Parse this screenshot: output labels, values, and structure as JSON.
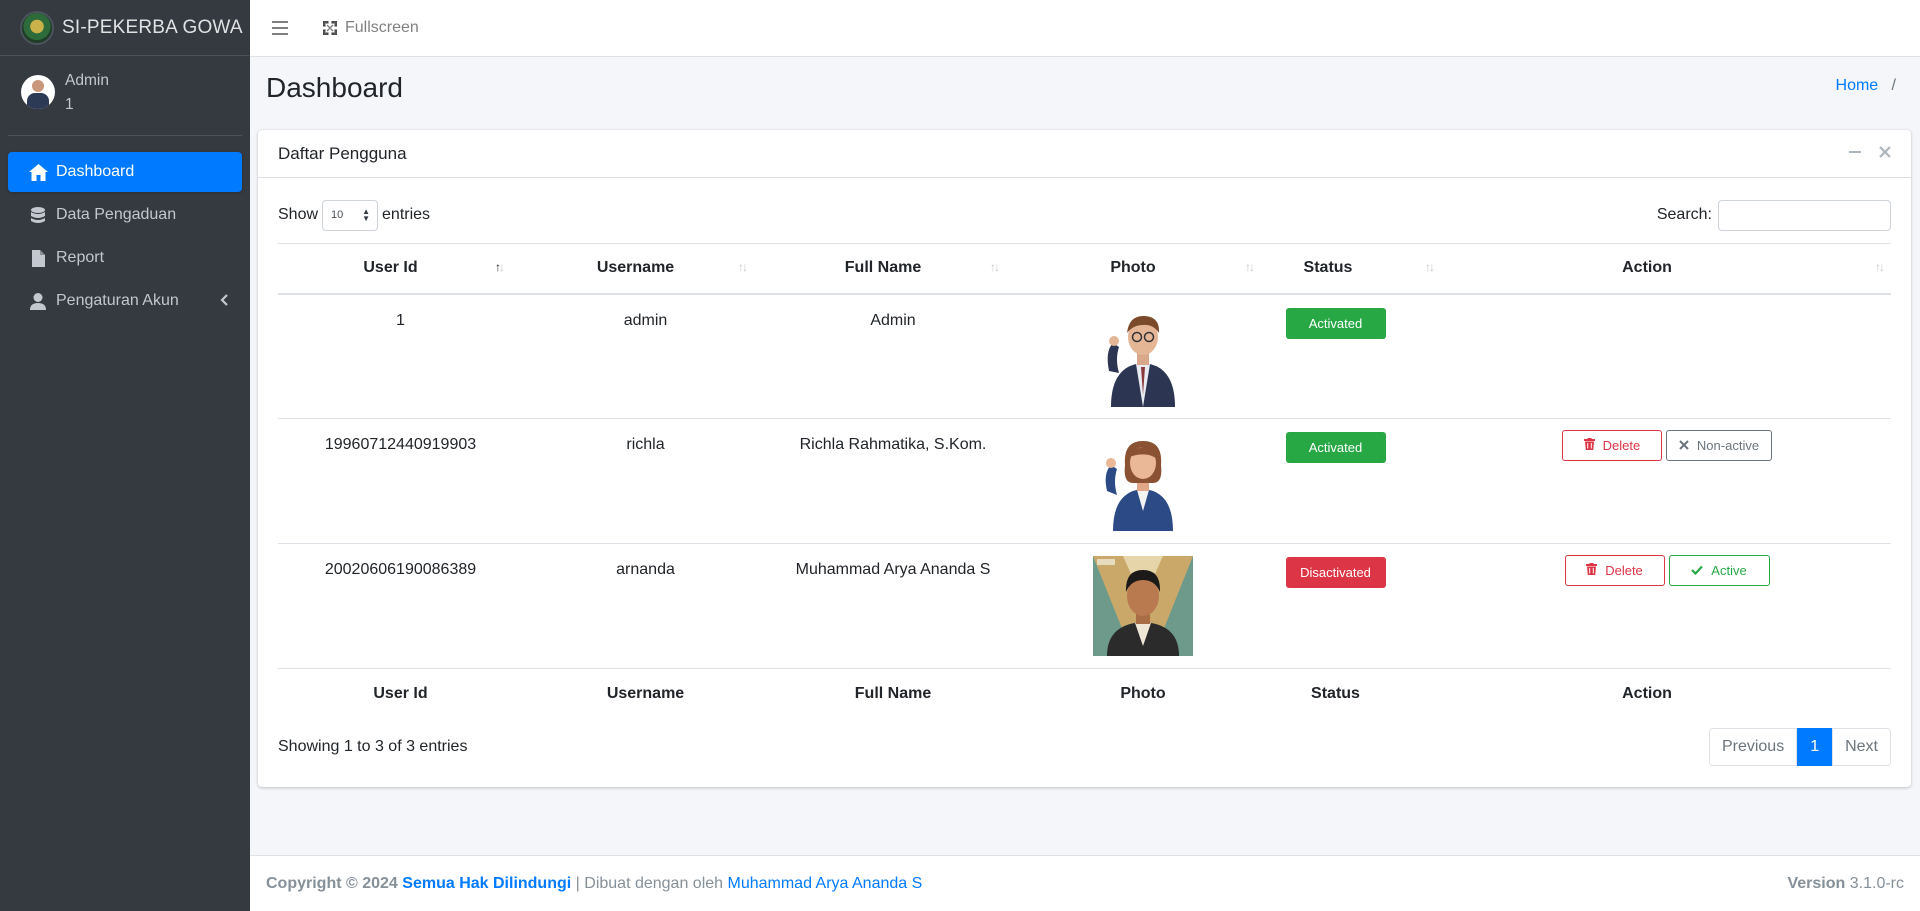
{
  "brand": {
    "title": "SI-PEKERBA GOWA"
  },
  "user_panel": {
    "name": "Admin",
    "id": "1"
  },
  "sidebar": {
    "items": [
      {
        "label": "Dashboard",
        "icon": "home-icon",
        "active": true
      },
      {
        "label": "Data Pengaduan",
        "icon": "database-icon"
      },
      {
        "label": "Report",
        "icon": "file-icon"
      },
      {
        "label": "Pengaturan Akun",
        "icon": "user-icon"
      }
    ]
  },
  "navbar": {
    "fullscreen_label": "Fullscreen"
  },
  "page": {
    "title": "Dashboard",
    "breadcrumb_home": "Home",
    "breadcrumb_sep": "/"
  },
  "card": {
    "title": "Daftar Pengguna",
    "show_label": "Show",
    "entries_label": "entries",
    "page_length": "10",
    "search_label": "Search:",
    "search_value": ""
  },
  "table": {
    "columns": [
      "User Id",
      "Username",
      "Full Name",
      "Photo",
      "Status",
      "Action"
    ],
    "rows": [
      {
        "user_id": "1",
        "username": "admin",
        "full_name": "Admin",
        "status": "Activated"
      },
      {
        "user_id": "19960712440919903",
        "username": "richla",
        "full_name": "Richla Rahmatika, S.Kom.",
        "status": "Activated",
        "delete": "Delete",
        "toggle": "Non-active"
      },
      {
        "user_id": "20020606190086389",
        "username": "arnanda",
        "full_name": "Muhammad Arya Ananda S",
        "status": "Disactivated",
        "delete": "Delete",
        "toggle": "Active"
      }
    ]
  },
  "pagination": {
    "info": "Showing 1 to 3 of 3 entries",
    "previous": "Previous",
    "current": "1",
    "next": "Next"
  },
  "footer": {
    "copyright": "Copyright © 2024",
    "rights": "Semua Hak Dilindungi",
    "divider": "|",
    "made_by": "Dibuat dengan oleh",
    "author": "Muhammad Arya Ananda S",
    "version_label": "Version",
    "version": "3.1.0-rc"
  },
  "colors": {
    "primary": "#007bff",
    "success": "#28a745",
    "danger": "#dc3545",
    "sidebar": "#343a40"
  }
}
